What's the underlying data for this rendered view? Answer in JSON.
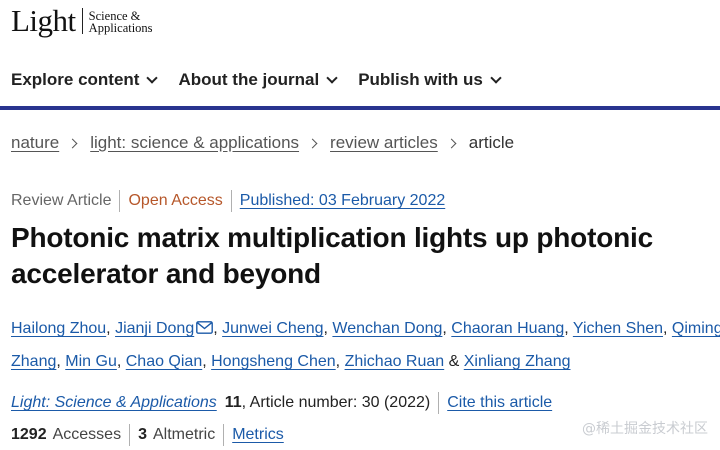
{
  "logo": {
    "main": "Light",
    "sub_line1": "Science &",
    "sub_line2": "Applications"
  },
  "nav": {
    "items": [
      {
        "label": "Explore content"
      },
      {
        "label": "About the journal"
      },
      {
        "label": "Publish with us"
      }
    ],
    "rule_color": "#29348f"
  },
  "breadcrumb": {
    "items": [
      {
        "label": "nature"
      },
      {
        "label": "light: science & applications"
      },
      {
        "label": "review articles"
      }
    ],
    "current": "article"
  },
  "article_meta": {
    "type": "Review Article",
    "access": "Open Access",
    "published": "Published: 03 February 2022"
  },
  "title": "Photonic matrix multiplication lights up photonic accelerator and beyond",
  "authors": [
    {
      "name": "Hailong Zhou",
      "sep": ", "
    },
    {
      "name": "Jianji Dong",
      "sep": ", ",
      "has_email": true
    },
    {
      "name": "Junwei Cheng",
      "sep": ", "
    },
    {
      "name": "Wenchan Dong",
      "sep": ", "
    },
    {
      "name": "Chaoran Huang",
      "sep": ", "
    },
    {
      "name": "Yichen Shen",
      "sep": ", "
    },
    {
      "name": "Qiming Zhang",
      "sep": ", "
    },
    {
      "name": "Min Gu",
      "sep": ", "
    },
    {
      "name": "Chao Qian",
      "sep": ", "
    },
    {
      "name": "Hongsheng Chen",
      "sep": ", "
    },
    {
      "name": "Zhichao Ruan",
      "sep": " & "
    },
    {
      "name": "Xinliang Zhang",
      "sep": ""
    }
  ],
  "journal": {
    "name": "Light: Science & Applications",
    "volume": "11",
    "article_info": ", Article number: 30 (2022)",
    "cite_label": "Cite this article"
  },
  "metrics": {
    "accesses_count": "1292",
    "accesses_label": "Accesses",
    "altmetric_count": "3",
    "altmetric_label": "Altmetric",
    "metrics_link": "Metrics"
  },
  "watermark": "@稀土掘金技术社区",
  "colors": {
    "link": "#1b5aa8",
    "open_access": "#b6572a",
    "nav_rule": "#29348f"
  },
  "icons": {
    "nav_dropdown": "chevron-down-icon",
    "breadcrumb_sep": "chevron-right-icon",
    "author_email": "mail-icon"
  }
}
